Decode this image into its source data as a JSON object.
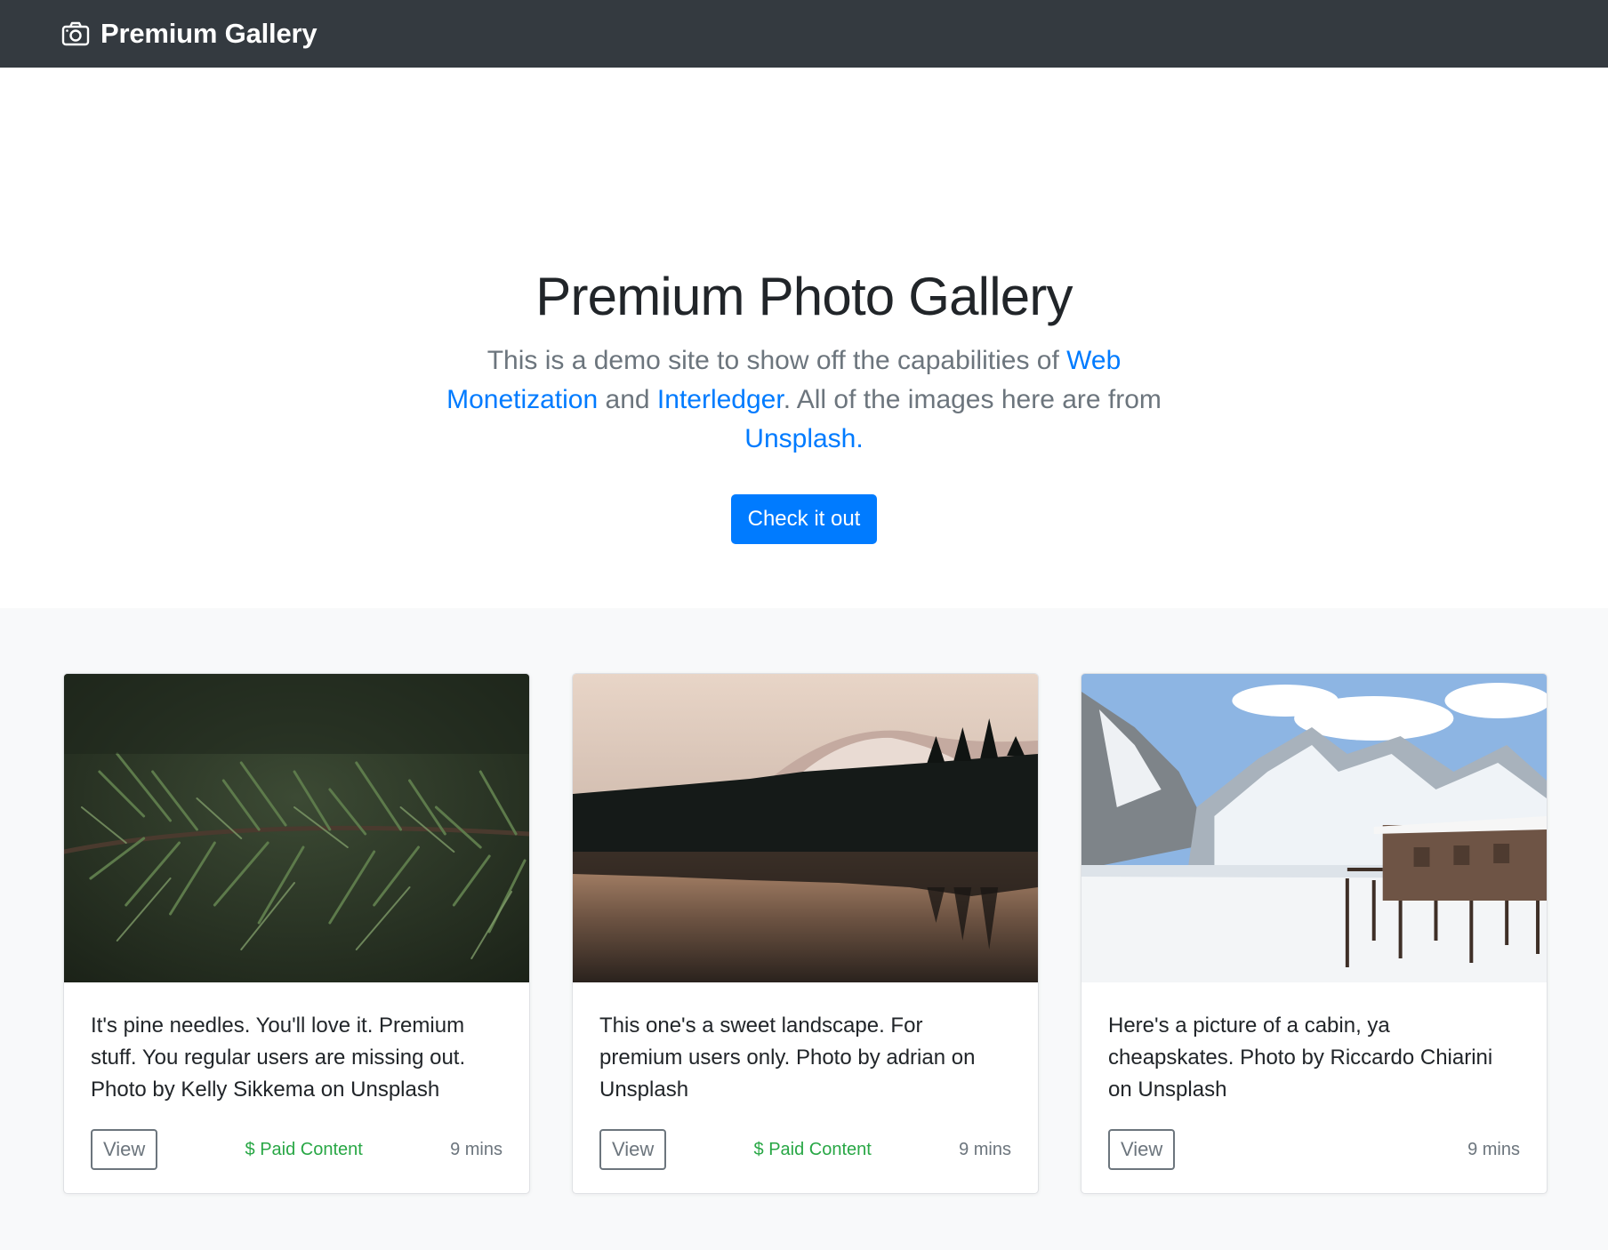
{
  "navbar": {
    "brand": "Premium Gallery",
    "brand_icon": "camera-icon"
  },
  "hero": {
    "title": "Premium Photo Gallery",
    "lead_part1": "This is a demo site to show off the capabilities of ",
    "link_web_monetization": "Web Monetization",
    "lead_part2": " and ",
    "link_interledger": "Interledger",
    "lead_part3": ". All of the images here are from ",
    "link_unsplash": "Unsplash",
    "lead_part4": ".",
    "cta_label": "Check it out"
  },
  "cards": [
    {
      "image": "pine-needles-photo",
      "text": "It's pine needles. You'll love it. Premium stuff. You regular users are missing out. Photo by Kelly Sikkema on Unsplash",
      "view_label": "View",
      "badge": "$ Paid Content",
      "time": "9 mins"
    },
    {
      "image": "mountain-lake-landscape-photo",
      "text": "This one's a sweet landscape. For premium users only. Photo by adrian on Unsplash",
      "view_label": "View",
      "badge": "$ Paid Content",
      "time": "9 mins"
    },
    {
      "image": "snowy-cabin-photo",
      "text": "Here's a picture of a cabin, ya cheapskates. Photo by Riccardo Chiarini on Unsplash",
      "view_label": "View",
      "badge": "",
      "time": "9 mins"
    }
  ],
  "colors": {
    "navbar_bg": "#343a40",
    "primary": "#007bff",
    "success": "#28a745",
    "muted": "#6c757d",
    "section_bg": "#f8f9fa"
  }
}
